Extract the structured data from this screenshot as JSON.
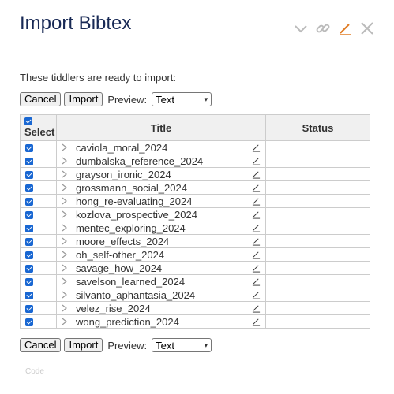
{
  "header": {
    "title": "Import Bibtex"
  },
  "toolbar": [
    "chevron-down",
    "link",
    "edit",
    "close"
  ],
  "colors": {
    "title": "#182955",
    "edit_accent": "#e07c24",
    "checkbox": "#1967d2"
  },
  "intro": "These tiddlers are ready to import:",
  "controls": {
    "cancel_label": "Cancel",
    "import_label": "Import",
    "preview_label": "Preview:",
    "preview_value": "Text"
  },
  "table": {
    "headers": {
      "select": "Select",
      "title": "Title",
      "status": "Status"
    },
    "rows": [
      {
        "title": "caviola_moral_2024",
        "checked": true,
        "status": ""
      },
      {
        "title": "dumbalska_reference_2024",
        "checked": true,
        "status": ""
      },
      {
        "title": "grayson_ironic_2024",
        "checked": true,
        "status": ""
      },
      {
        "title": "grossmann_social_2024",
        "checked": true,
        "status": ""
      },
      {
        "title": "hong_re-evaluating_2024",
        "checked": true,
        "status": ""
      },
      {
        "title": "kozlova_prospective_2024",
        "checked": true,
        "status": ""
      },
      {
        "title": "mentec_exploring_2024",
        "checked": true,
        "status": ""
      },
      {
        "title": "moore_effects_2024",
        "checked": true,
        "status": ""
      },
      {
        "title": "oh_self-other_2024",
        "checked": true,
        "status": ""
      },
      {
        "title": "savage_how_2024",
        "checked": true,
        "status": ""
      },
      {
        "title": "savelson_learned_2024",
        "checked": true,
        "status": ""
      },
      {
        "title": "silvanto_aphantasia_2024",
        "checked": true,
        "status": ""
      },
      {
        "title": "velez_rise_2024",
        "checked": true,
        "status": ""
      },
      {
        "title": "wong_prediction_2024",
        "checked": true,
        "status": ""
      }
    ]
  },
  "footer": {
    "code_label": "Code"
  }
}
